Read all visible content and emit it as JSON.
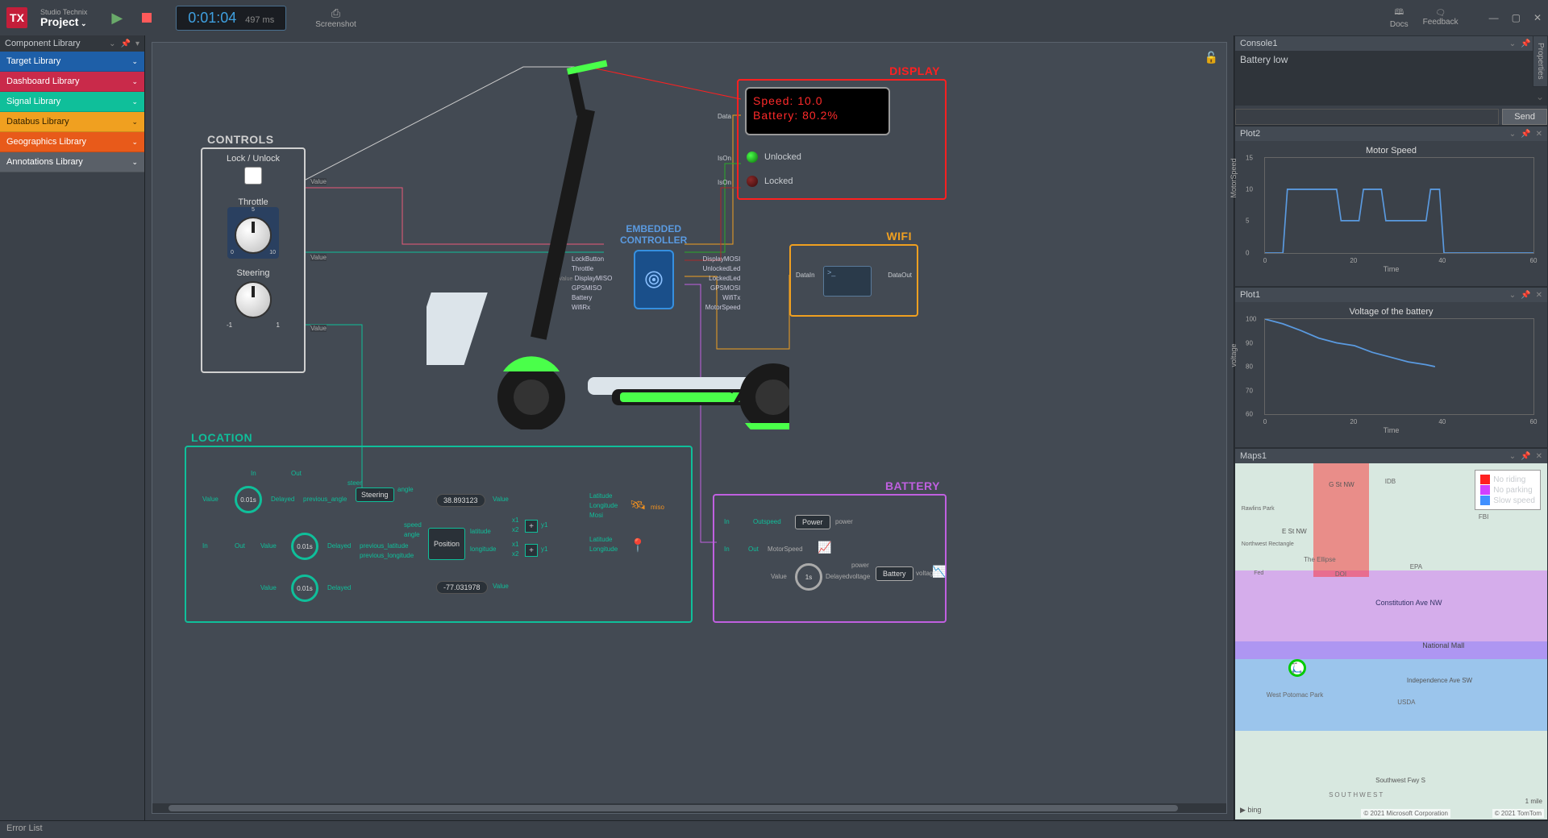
{
  "app": {
    "brand": "TX",
    "suite": "Studio Technix",
    "project": "Project"
  },
  "toolbar": {
    "time_main": "0:01:04",
    "time_ms": "497",
    "time_unit": "ms",
    "screenshot": "Screenshot",
    "docs": "Docs",
    "feedback": "Feedback"
  },
  "left_panel": {
    "title": "Component Library",
    "items": [
      "Target Library",
      "Dashboard Library",
      "Signal Library",
      "Databus Library",
      "Geographics Library",
      "Annotations Library"
    ]
  },
  "canvas": {
    "controls": {
      "title": "CONTROLS",
      "lock_label": "Lock / Unlock",
      "lock_value_tag": "Value",
      "throttle_label": "Throttle",
      "throttle_ticks": [
        "0",
        "1",
        "2",
        "3",
        "4",
        "5",
        "6",
        "7",
        "8",
        "9",
        "10"
      ],
      "throttle_value_tag": "Value",
      "steering_label": "Steering",
      "steering_min": "-1",
      "steering_max": "1",
      "steering_value_tag": "Value"
    },
    "ec": {
      "title1": "EMBEDDED",
      "title2": "CONTROLLER",
      "pins_left": [
        "LockButton",
        "Throttle",
        "DisplayMISO",
        "GPSMISO",
        "Battery",
        "WifiRx"
      ],
      "pins_right": [
        "DisplayMOSI",
        "UnlockedLed",
        "LockedLed",
        "GPSMOSI",
        "WifiTx",
        "MotorSpeed"
      ],
      "value_tag": "Value"
    },
    "display": {
      "title": "DISPLAY",
      "line1": "Speed: 10.0",
      "line2": "Battery: 80.2%",
      "unlocked": "Unlocked",
      "locked": "Locked",
      "data_tag": "Data",
      "ison1": "IsOn",
      "ison2": "IsOn"
    },
    "wifi": {
      "title": "WIFI",
      "datain": "DataIn",
      "dataout": "DataOut"
    },
    "location": {
      "title": "LOCATION",
      "in": "In",
      "out": "Out",
      "value": "Value",
      "delayed": "Delayed",
      "delay": "0.01s",
      "steer": "steer",
      "angle": "angle",
      "prev_angle": "previous_angle",
      "steering_box": "Steering",
      "position_box": "Position",
      "speed": "speed",
      "latitude": "latitude",
      "longitude": "longitude",
      "prev_lat": "previous_latitude",
      "prev_lon": "previous_longitude",
      "lat_val": "38.893123",
      "lon_val": "-77.031978",
      "x1": "x1",
      "x2": "x2",
      "y1": "y1",
      "Latitude": "Latitude",
      "Longitude": "Longitude",
      "Mosi": "Mosi",
      "miso": "miso"
    },
    "battery": {
      "title": "BATTERY",
      "in": "In",
      "out": "Out",
      "outspeed": "Outspeed",
      "motorspeed": "MotorSpeed",
      "power_box": "Power",
      "power": "power",
      "value": "Value",
      "delay": "1s",
      "delayed_voltage": "Delayedvoltage",
      "battery_box": "Battery",
      "voltage": "voltage"
    }
  },
  "right": {
    "properties_tab": "Properties",
    "console": {
      "title": "Console1",
      "log": "Battery low",
      "send": "Send"
    },
    "plot2": {
      "title": "Plot2",
      "chart_title": "Motor Speed",
      "ylabel": "MotorSpeed",
      "xlabel": "Time"
    },
    "plot1": {
      "title": "Plot1",
      "chart_title": "Voltage of the battery",
      "ylabel": "voltage",
      "xlabel": "Time"
    },
    "maps": {
      "title": "Maps1",
      "legend": [
        {
          "color": "#ff2020",
          "label": "No riding"
        },
        {
          "color": "#d040ff",
          "label": "No parking"
        },
        {
          "color": "#4090ff",
          "label": "Slow speed"
        }
      ],
      "streets": [
        "G St NW",
        "E St NW",
        "Constitution Ave NW",
        "Independence Ave SW",
        "Southwest Fwy S"
      ],
      "places": [
        "IDB",
        "FBI",
        "The Ellipse",
        "EPA",
        "DOI",
        "National Mall",
        "USDA",
        "West Potomac Park",
        "Rawlins Park",
        "Northwest Rectangle",
        "Fed",
        "SOUTHWEST"
      ],
      "scale": "1 mile",
      "attr1": "© 2021 Microsoft Corporation",
      "attr2": "© 2021 TomTom",
      "bing": "bing"
    }
  },
  "status": {
    "error_list": "Error List"
  },
  "chart_data": [
    {
      "type": "line",
      "title": "Motor Speed",
      "xlabel": "Time",
      "ylabel": "MotorSpeed",
      "xlim": [
        0,
        60
      ],
      "ylim": [
        0,
        15
      ],
      "yticks": [
        0,
        5,
        10,
        15
      ],
      "xticks": [
        0,
        20,
        40,
        60
      ],
      "x": [
        0,
        4,
        5,
        16,
        17,
        21,
        22,
        26,
        27,
        36,
        37,
        39,
        40,
        60
      ],
      "values": [
        0,
        0,
        10,
        10,
        5,
        5,
        10,
        10,
        5,
        5,
        10,
        10,
        0,
        0
      ]
    },
    {
      "type": "line",
      "title": "Voltage of the battery",
      "xlabel": "Time",
      "ylabel": "voltage",
      "xlim": [
        0,
        60
      ],
      "ylim": [
        60,
        100
      ],
      "yticks": [
        60,
        70,
        80,
        90,
        100
      ],
      "xticks": [
        0,
        20,
        40,
        60
      ],
      "x": [
        0,
        4,
        8,
        12,
        16,
        20,
        24,
        28,
        32,
        36,
        38
      ],
      "values": [
        100,
        98,
        95,
        92,
        90,
        89,
        86,
        84,
        82,
        81,
        80
      ]
    }
  ]
}
